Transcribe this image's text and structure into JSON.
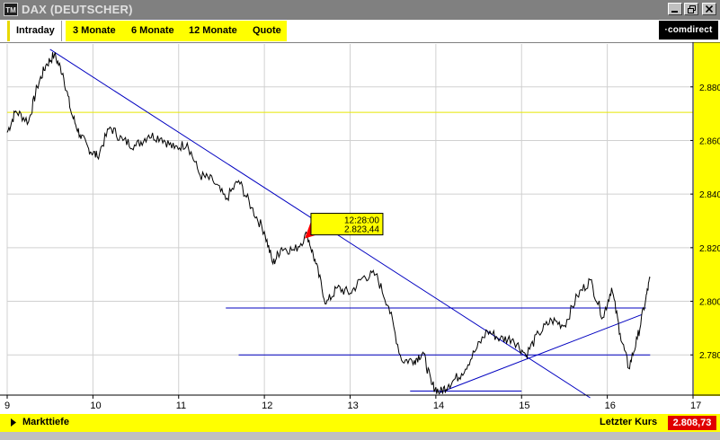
{
  "window": {
    "title": "DAX (DEUTSCHER)",
    "icon": "TM"
  },
  "tabs": [
    {
      "label": "Intraday",
      "active": true
    },
    {
      "label": "3 Monate",
      "active": false
    },
    {
      "label": "6 Monate",
      "active": false
    },
    {
      "label": "12 Monate",
      "active": false
    },
    {
      "label": "Quote",
      "active": false
    }
  ],
  "brand": {
    "logo_text": "·comdirect"
  },
  "tooltip": {
    "time": "12:28:00",
    "value": "2.823,44"
  },
  "footer": {
    "left_label": "Markttiefe",
    "right_label": "Letzter Kurs",
    "last_price": "2.808,73"
  },
  "colors": {
    "accent": "#ffff00",
    "trendline": "#0000c0",
    "price_line": "#000000",
    "last_price_bg": "#e00000",
    "titlebar": "#808080"
  },
  "icons": {
    "app": "app-icon",
    "minimize": "minimize-icon",
    "restore": "restore-icon",
    "close": "close-icon",
    "footer_arrow": "triangle-right-icon"
  },
  "chart_data": {
    "type": "line",
    "xlim": [
      9,
      17
    ],
    "ylim": [
      2765,
      2896
    ],
    "x_ticks": [
      9,
      10,
      11,
      12,
      13,
      14,
      15,
      16,
      17
    ],
    "x_tick_labels": [
      "9",
      "10",
      "11",
      "12",
      "13",
      "14",
      "15",
      "16",
      "17"
    ],
    "y_ticks": [
      2780,
      2800,
      2820,
      2840,
      2860,
      2880
    ],
    "y_tick_labels": [
      "2.780",
      "2.800",
      "2.820",
      "2.840",
      "2.860",
      "2.880"
    ],
    "grid": true,
    "series": [
      {
        "x": [
          9.0,
          9.1,
          9.25,
          9.35,
          9.45,
          9.55,
          9.65,
          9.75,
          9.85,
          9.95,
          10.05,
          10.2,
          10.35,
          10.5,
          10.65,
          10.8,
          10.95,
          11.1,
          11.25,
          11.4,
          11.55,
          11.7,
          11.85,
          12.0,
          12.1,
          12.2,
          12.35,
          12.5,
          12.6,
          12.72,
          12.85,
          13.0,
          13.15,
          13.3,
          13.45,
          13.6,
          13.75,
          13.85,
          13.95,
          14.05,
          14.15,
          14.3,
          14.45,
          14.6,
          14.75,
          14.9,
          15.05,
          15.2,
          15.35,
          15.5,
          15.65,
          15.8,
          15.95,
          16.05,
          16.15,
          16.25,
          16.35,
          16.45,
          16.5
        ],
        "y": [
          2863,
          2871,
          2867,
          2880,
          2888,
          2892,
          2885,
          2870,
          2862,
          2857,
          2854,
          2865,
          2860,
          2858,
          2862,
          2861,
          2857,
          2859,
          2847,
          2845,
          2838,
          2845,
          2835,
          2826,
          2814,
          2820,
          2819,
          2825,
          2814,
          2799,
          2805,
          2803,
          2809,
          2810,
          2798,
          2778,
          2778,
          2781,
          2769,
          2766,
          2769,
          2773,
          2781,
          2789,
          2786,
          2786,
          2780,
          2788,
          2793,
          2791,
          2802,
          2808,
          2794,
          2805,
          2788,
          2775,
          2786,
          2801,
          2808.73
        ]
      }
    ],
    "trendlines": [
      {
        "x": [
          9.5,
          15.8
        ],
        "y": [
          2894,
          2764
        ]
      },
      {
        "x": [
          14.05,
          16.4
        ],
        "y": [
          2766,
          2795
        ]
      },
      {
        "x": [
          11.55,
          16.45
        ],
        "y": [
          2797.5,
          2797.5
        ]
      },
      {
        "x": [
          11.7,
          16.5
        ],
        "y": [
          2780,
          2780
        ]
      },
      {
        "x": [
          13.7,
          15.0
        ],
        "y": [
          2766.5,
          2766.5
        ]
      }
    ],
    "reference_line": {
      "y": 2870.5,
      "color": "#e8e800"
    },
    "tooltip_point": {
      "x": 12.47,
      "y": 2823.44
    }
  }
}
